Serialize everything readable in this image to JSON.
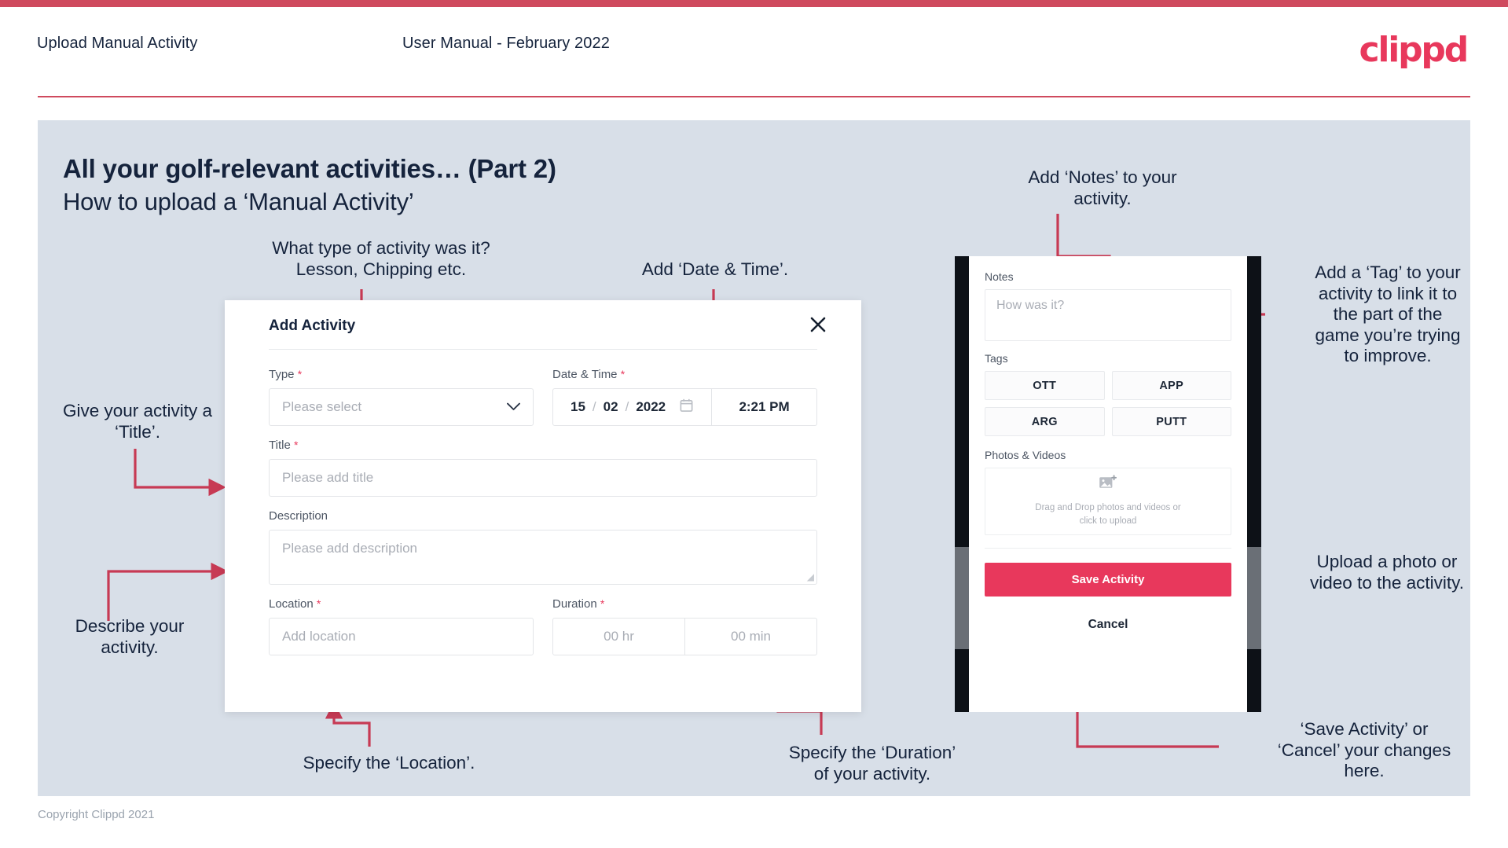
{
  "header": {
    "title": "Upload Manual Activity",
    "subtitle": "User Manual - February 2022",
    "logo": "clippd"
  },
  "slide": {
    "heading": "All your golf-relevant activities… (Part 2)",
    "subheading": "How to upload a ‘Manual Activity’",
    "copyright": "Copyright Clippd 2021"
  },
  "annotations": {
    "type": "What type of activity was it?\nLesson, Chipping etc.",
    "datetime": "Add ‘Date & Time’.",
    "title": "Give your activity a\n‘Title’.",
    "description": "Describe your\nactivity.",
    "location": "Specify the ‘Location’.",
    "duration": "Specify the ‘Duration’\nof your activity.",
    "notes": "Add ‘Notes’ to your\nactivity.",
    "tags": "Add a ‘Tag’ to your\nactivity to link it to\nthe part of the\ngame you’re trying\nto improve.",
    "upload": "Upload a photo or\nvideo to the activity.",
    "save": "‘Save Activity’ or\n‘Cancel’ your changes\nhere."
  },
  "dialog": {
    "title": "Add Activity",
    "close_icon": "close-icon",
    "fields": {
      "type": {
        "label": "Type",
        "required": "*",
        "placeholder": "Please select",
        "chevron": "chevron-down-icon"
      },
      "datetime": {
        "label": "Date & Time",
        "required": "*",
        "day": "15",
        "month": "02",
        "year": "2022",
        "sep": "/",
        "calendar_icon": "calendar-icon",
        "time": "2:21 PM"
      },
      "title": {
        "label": "Title",
        "required": "*",
        "placeholder": "Please add title"
      },
      "description": {
        "label": "Description",
        "required": "",
        "placeholder": "Please add description"
      },
      "location": {
        "label": "Location",
        "required": "*",
        "placeholder": "Add location"
      },
      "duration": {
        "label": "Duration",
        "required": "*",
        "hours_placeholder": "00 hr",
        "minutes_placeholder": "00 min"
      }
    }
  },
  "phone": {
    "notes": {
      "label": "Notes",
      "placeholder": "How was it?"
    },
    "tags": {
      "label": "Tags",
      "items": [
        "OTT",
        "APP",
        "ARG",
        "PUTT"
      ]
    },
    "photos": {
      "label": "Photos & Videos",
      "icon": "add-image-icon",
      "line1": "Drag and Drop photos and videos or",
      "line2": "click to upload"
    },
    "save_label": "Save Activity",
    "cancel_label": "Cancel"
  },
  "colors": {
    "accent": "#e8385c",
    "header_rule": "#cf4a5e",
    "slide_bg": "#d8dfe8",
    "text": "#15233c"
  }
}
